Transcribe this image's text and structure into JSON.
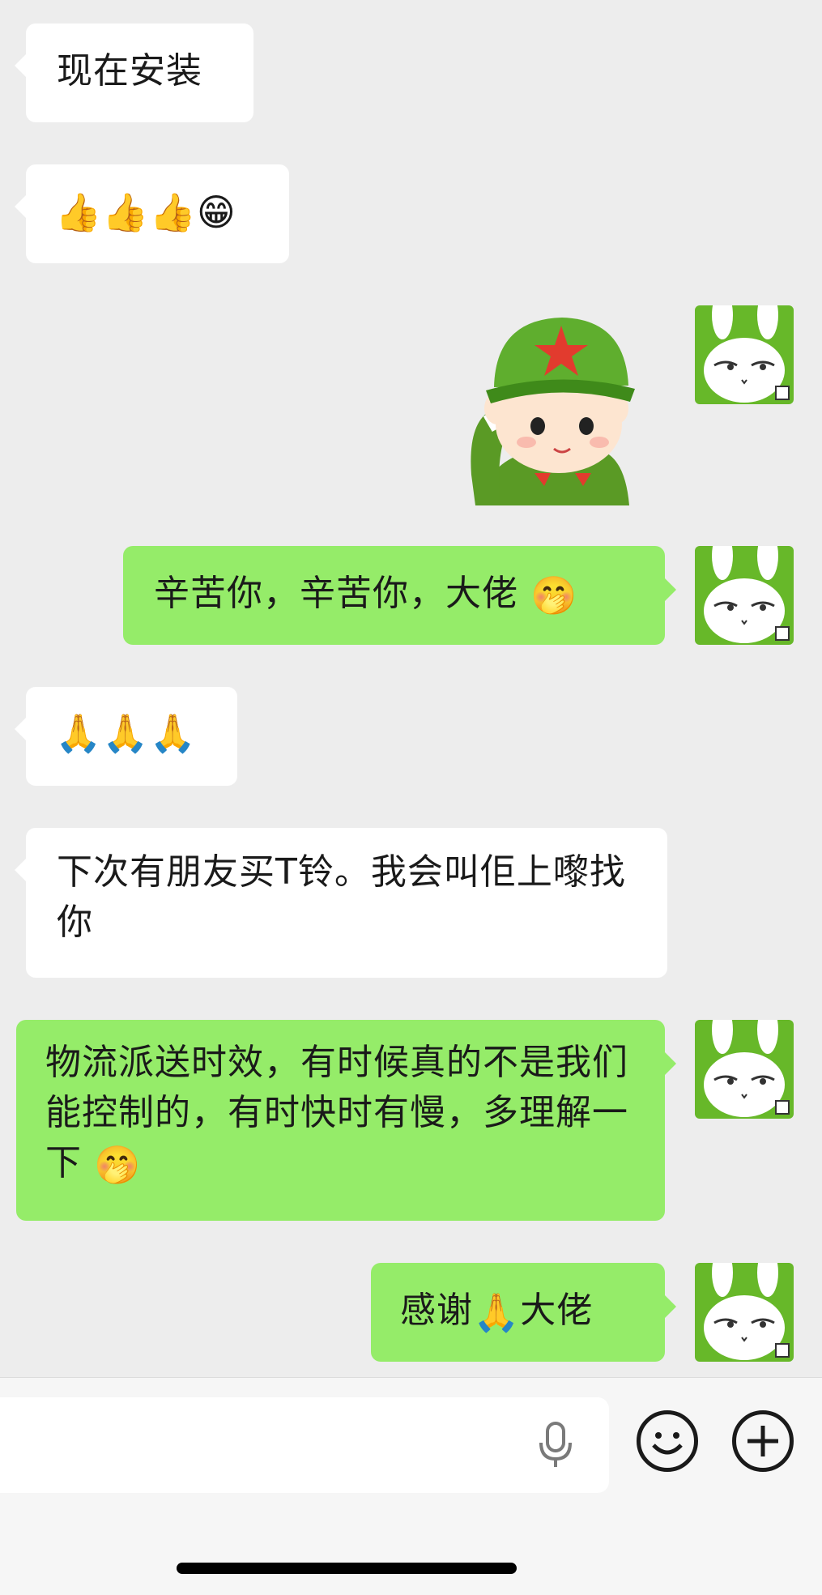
{
  "messages": [
    {
      "direction": "in",
      "text": "现在安装"
    },
    {
      "direction": "in",
      "emoji": "👍👍👍😁"
    },
    {
      "direction": "out",
      "sticker": "saluting-soldier"
    },
    {
      "direction": "out",
      "text": "辛苦你，辛苦你，大佬",
      "emoji": "🤭"
    },
    {
      "direction": "in",
      "emoji": "🙏🙏🙏"
    },
    {
      "direction": "in",
      "text": "下次有朋友买T铃。我会叫佢上嚟找你"
    },
    {
      "direction": "out",
      "text": "物流派送时效，有时候真的不是我们能控制的，有时快时有慢，多理解一下",
      "emoji": "🤭"
    },
    {
      "direction": "out",
      "text_before": "感谢",
      "emoji": "🙏",
      "text_after": "大佬"
    }
  ],
  "icons": {
    "avatar": "white-rabbit-avatar-icon",
    "voice": "microphone-icon",
    "emoji_button": "smiley-face-icon",
    "more_button": "plus-icon"
  },
  "colors": {
    "background": "#ededed",
    "incoming_bubble": "#ffffff",
    "outgoing_bubble": "#95ec69",
    "avatar_bg": "#67b829"
  }
}
